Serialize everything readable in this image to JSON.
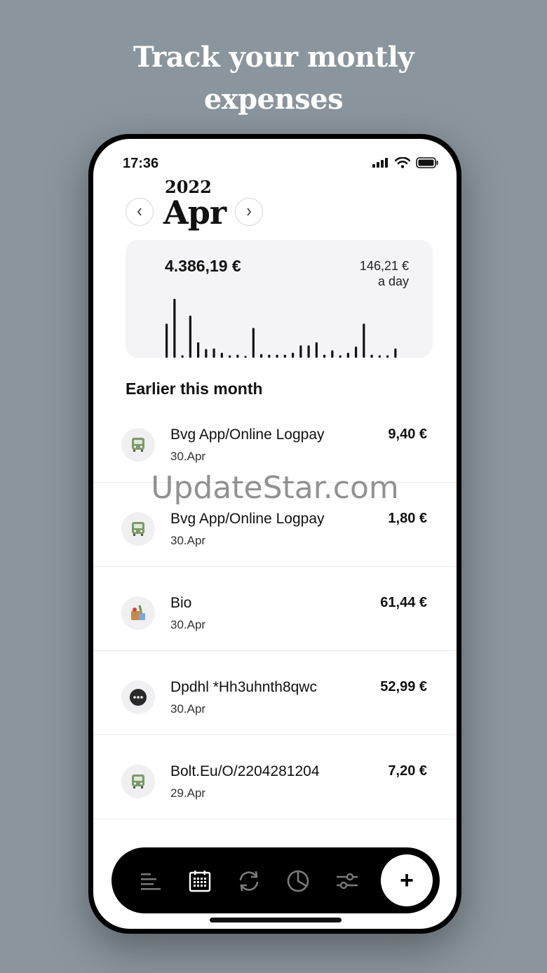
{
  "promo": {
    "line1": "Track your montly",
    "line2": "expenses"
  },
  "status": {
    "time": "17:36"
  },
  "header": {
    "year": "2022",
    "month": "Apr",
    "prev_icon": "chevron-left-icon",
    "next_icon": "chevron-right-icon"
  },
  "summary": {
    "total": "4.386,19 €",
    "per_day_value": "146,21 €",
    "per_day_label": "a day"
  },
  "chart_data": {
    "type": "bar",
    "daily_values": [
      55,
      95,
      4,
      68,
      25,
      14,
      15,
      8,
      4,
      5,
      3,
      48,
      6,
      5,
      5,
      5,
      8,
      20,
      20,
      25,
      5,
      12,
      4,
      8,
      18,
      55,
      5,
      4,
      4,
      15
    ]
  },
  "section": {
    "title": "Earlier this month"
  },
  "transactions": [
    {
      "name": "Bvg App/Online Logpay",
      "date": "30.Apr",
      "amount": "9,40 €",
      "icon": "bus-icon"
    },
    {
      "name": "Bvg App/Online Logpay",
      "date": "30.Apr",
      "amount": "1,80 €",
      "icon": "bus-icon"
    },
    {
      "name": "Bio",
      "date": "30.Apr",
      "amount": "61,44 €",
      "icon": "groceries-icon"
    },
    {
      "name": "Dpdhl *Hh3uhnth8qwc",
      "date": "30.Apr",
      "amount": "52,99 €",
      "icon": "more-icon"
    },
    {
      "name": "Bolt.Eu/O/2204281204",
      "date": "29.Apr",
      "amount": "7,20 €",
      "icon": "bus-icon"
    }
  ],
  "watermark": "UpdateStar.com",
  "tabbar": {
    "add_label": "+"
  },
  "colors": {
    "background": "#8a959d",
    "card": "#f4f4f6",
    "bus_green": "#7d9a6a"
  }
}
